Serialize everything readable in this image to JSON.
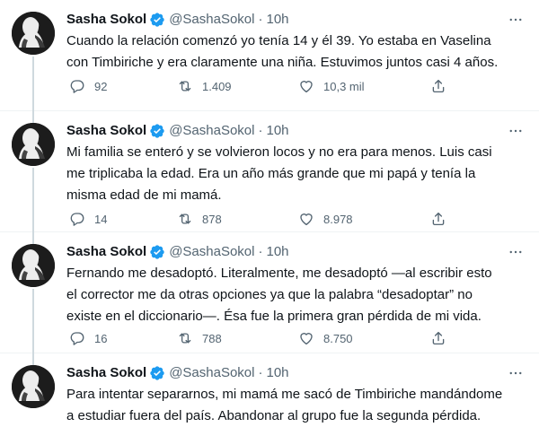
{
  "tweets": [
    {
      "name": "Sasha Sokol",
      "handle": "@SashaSokol",
      "separator": "·",
      "time": "10h",
      "text": "Cuando la relación comenzó yo tenía 14 y él 39. Yo estaba en Vaselina con Timbiriche y era claramente una niña. Estuvimos juntos casi 4 años.",
      "replies": "92",
      "retweets": "1.409",
      "likes": "10,3 mil"
    },
    {
      "name": "Sasha Sokol",
      "handle": "@SashaSokol",
      "separator": "·",
      "time": "10h",
      "text": "Mi familia se enteró y se volvieron locos y no era para menos. Luis casi me triplicaba la edad. Era un año más grande que mi papá y tenía la misma edad de mi mamá.",
      "replies": "14",
      "retweets": "878",
      "likes": "8.978"
    },
    {
      "name": "Sasha Sokol",
      "handle": "@SashaSokol",
      "separator": "·",
      "time": "10h",
      "text": "Fernando me desadoptó. Literalmente, me desadoptó —al escribir esto el corrector me da otras opciones ya que la palabra “desadoptar” no existe en el diccionario—. Ésa fue la primera gran pérdida de mi vida.",
      "replies": "16",
      "retweets": "788",
      "likes": "8.750"
    },
    {
      "name": "Sasha Sokol",
      "handle": "@SashaSokol",
      "separator": "·",
      "time": "10h",
      "text": "Para intentar separarnos, mi mamá me sacó de Timbiriche mandándome a estudiar fuera del país. Abandonar al grupo fue la segunda pérdida."
    }
  ],
  "icons": {
    "verified": "verified-badge-icon",
    "more": "more-options-icon",
    "reply": "reply-icon",
    "retweet": "retweet-icon",
    "like": "heart-icon",
    "share": "share-icon"
  },
  "colors": {
    "verified": "#1d9bf0",
    "secondary_text": "#536471",
    "thread_line": "#cfd9de"
  }
}
